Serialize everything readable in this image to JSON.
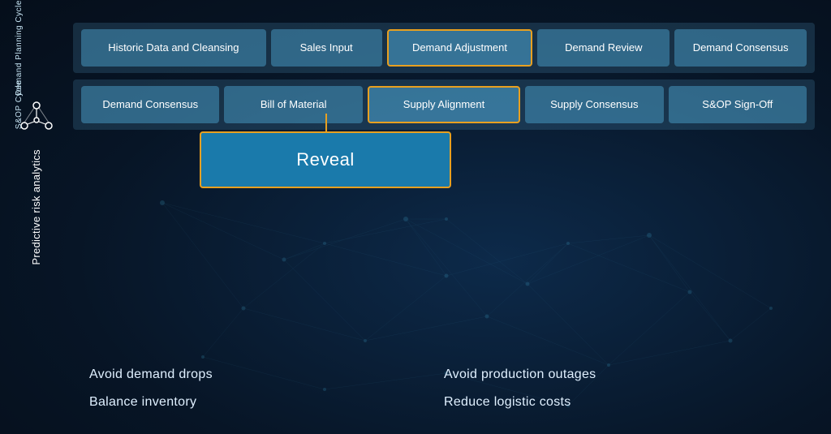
{
  "background": {
    "primary": "#0a1a2e",
    "secondary": "#071526"
  },
  "demand_planning_row": {
    "label": "Demand Planning Cycle",
    "cells": [
      {
        "id": "historic-data",
        "text": "Historic Data and Cleansing",
        "highlighted": false
      },
      {
        "id": "sales-input",
        "text": "Sales Input",
        "highlighted": false
      },
      {
        "id": "demand-adjustment",
        "text": "Demand Adjustment",
        "highlighted": true
      },
      {
        "id": "demand-review",
        "text": "Demand Review",
        "highlighted": false
      },
      {
        "id": "demand-consensus-dp",
        "text": "Demand Consensus",
        "highlighted": false
      }
    ]
  },
  "sop_row": {
    "label": "S&OP Cycle",
    "cells": [
      {
        "id": "demand-consensus-sop",
        "text": "Demand Consensus",
        "highlighted": false
      },
      {
        "id": "bill-of-material",
        "text": "Bill of Material",
        "highlighted": false
      },
      {
        "id": "supply-alignment",
        "text": "Supply Alignment",
        "highlighted": true
      },
      {
        "id": "supply-consensus",
        "text": "Supply Consensus",
        "highlighted": false
      },
      {
        "id": "sop-signoff",
        "text": "S&OP Sign-Off",
        "highlighted": false
      }
    ]
  },
  "reveal_box": {
    "label": "Reveal"
  },
  "logo": {
    "text": "Predictive risk analytics"
  },
  "bottom_items": {
    "left": [
      {
        "id": "avoid-demand",
        "text": "Avoid demand drops"
      },
      {
        "id": "balance-inventory",
        "text": "Balance inventory"
      }
    ],
    "right": [
      {
        "id": "avoid-production",
        "text": "Avoid production outages"
      },
      {
        "id": "reduce-logistic",
        "text": "Reduce logistic costs"
      }
    ]
  }
}
